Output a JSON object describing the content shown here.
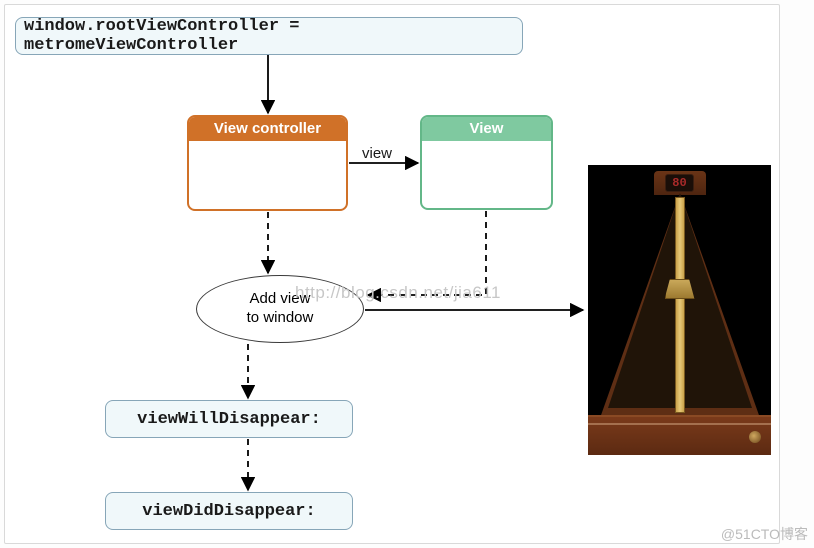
{
  "nodes": {
    "code_line": "window.rootViewController = metromeViewController",
    "view_controller_header": "View controller",
    "view_header": "View",
    "add_view": "Add view\nto window",
    "view_will_disappear": "viewWillDisappear:",
    "view_did_disappear": "viewDidDisappear:"
  },
  "edges": {
    "vc_to_view_label": "view"
  },
  "metronome": {
    "bpm": "80"
  },
  "watermarks": {
    "center": "http://blog.csdn.net/jia611",
    "corner": "@51CTO博客"
  },
  "chart_data": {
    "type": "flowchart",
    "nodes": [
      {
        "id": "code",
        "label": "window.rootViewController = metromeViewController",
        "shape": "rounded-rect",
        "style": "code-blue"
      },
      {
        "id": "vc",
        "label": "View controller",
        "shape": "titled-rect",
        "style": "orange"
      },
      {
        "id": "view",
        "label": "View",
        "shape": "titled-rect",
        "style": "green"
      },
      {
        "id": "addwin",
        "label": "Add view to window",
        "shape": "ellipse"
      },
      {
        "id": "vwill",
        "label": "viewWillDisappear:",
        "shape": "rounded-rect",
        "style": "code-blue"
      },
      {
        "id": "vdid",
        "label": "viewDidDisappear:",
        "shape": "rounded-rect",
        "style": "code-blue"
      },
      {
        "id": "metronome",
        "label": "metronome app screen (bpm 80)",
        "shape": "image"
      }
    ],
    "edges": [
      {
        "from": "code",
        "to": "vc",
        "style": "solid"
      },
      {
        "from": "vc",
        "to": "view",
        "style": "solid",
        "label": "view"
      },
      {
        "from": "vc",
        "to": "addwin",
        "style": "dashed"
      },
      {
        "from": "view",
        "to": "addwin",
        "style": "dashed"
      },
      {
        "from": "addwin",
        "to": "metronome",
        "style": "solid"
      },
      {
        "from": "addwin",
        "to": "vwill",
        "style": "dashed"
      },
      {
        "from": "vwill",
        "to": "vdid",
        "style": "dashed"
      }
    ]
  }
}
